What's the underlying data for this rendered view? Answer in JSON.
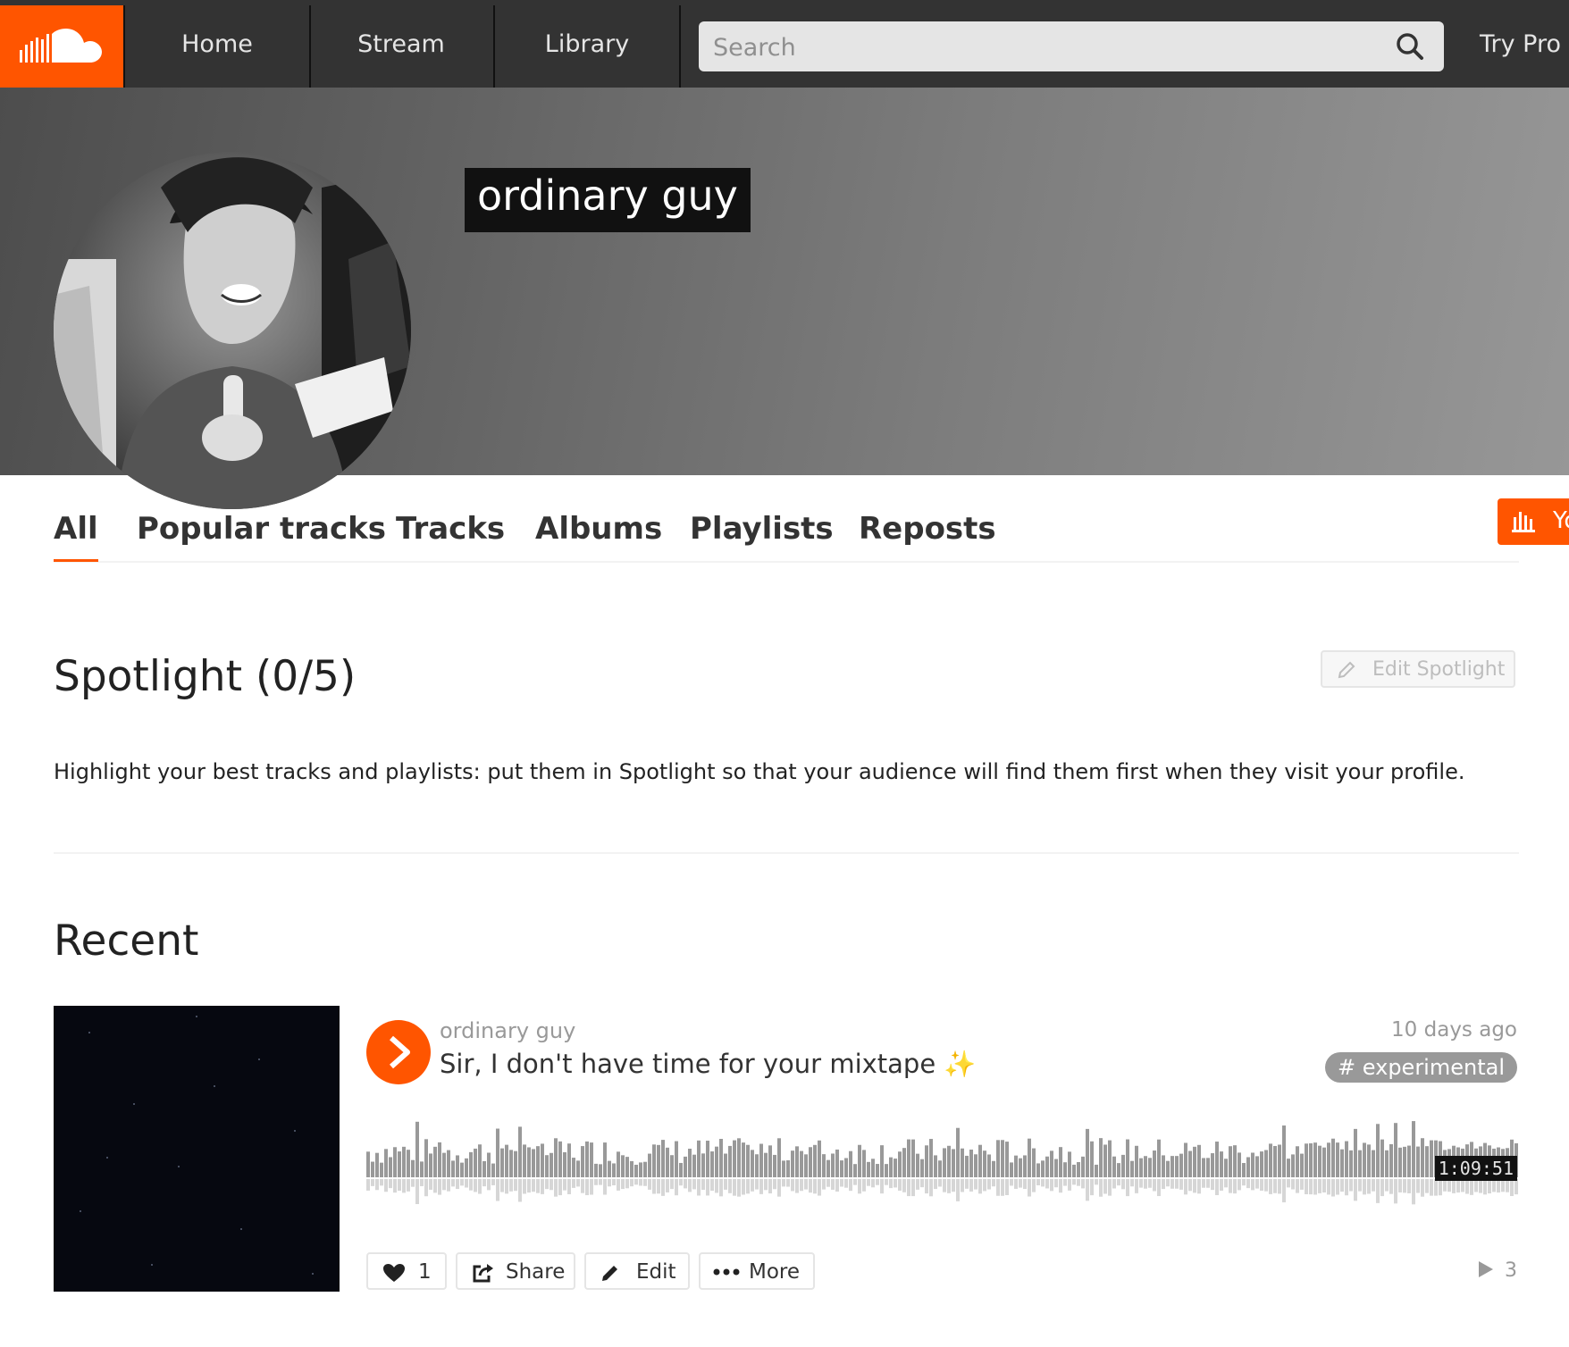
{
  "nav": {
    "logo_alt": "SoundCloud",
    "tabs": [
      "Home",
      "Stream",
      "Library"
    ],
    "search_placeholder": "Search",
    "try_pro": "Try Pro"
  },
  "profile": {
    "username": "ordinary guy"
  },
  "profile_tabs": {
    "items": [
      "All",
      "Popular tracks",
      "Tracks",
      "Albums",
      "Playlists",
      "Reposts"
    ],
    "active": "All",
    "insights_label": "Yo"
  },
  "spotlight": {
    "title": "Spotlight (0/5)",
    "edit_label": "Edit Spotlight",
    "description": "Highlight your best tracks and playlists: put them in Spotlight so that your audience will find them first when they visit your profile."
  },
  "recent": {
    "title": "Recent",
    "track": {
      "user": "ordinary guy",
      "title": "Sir, I don't have time for your mixtape",
      "title_emoji": "✨",
      "posted": "10 days ago",
      "tag": "# experimental",
      "duration": "1:09:51",
      "likes": "1",
      "share_label": "Share",
      "edit_label": "Edit",
      "more_label": "More",
      "plays": "3"
    }
  },
  "colors": {
    "accent": "#ff5500",
    "nav_bg": "#333333",
    "waveform": "#999999"
  },
  "icons": [
    "soundcloud-logo-icon",
    "search-icon",
    "insights-icon",
    "pencil-icon",
    "play-icon",
    "heart-icon",
    "share-icon",
    "edit-icon",
    "more-icon",
    "plays-icon"
  ]
}
